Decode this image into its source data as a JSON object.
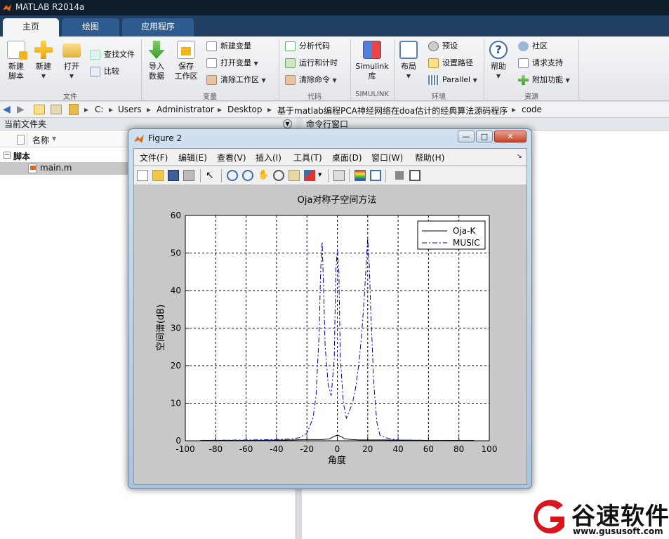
{
  "app": {
    "title": "MATLAB R2014a"
  },
  "tabs": [
    {
      "label": "主页"
    },
    {
      "label": "绘图"
    },
    {
      "label": "应用程序"
    }
  ],
  "ribbon": {
    "groups": {
      "file": "文件",
      "variable": "变量",
      "code": "代码",
      "simulink": "SIMULINK",
      "environment": "环境",
      "resources": "资源"
    },
    "new_script": "新建\n脚本",
    "new_script_l1": "新建",
    "new_script_l2": "脚本",
    "new": "新建",
    "open": "打开",
    "find_files": "查找文件",
    "compare": "比较",
    "import_l1": "导入",
    "import_l2": "数据",
    "save_ws_l1": "保存",
    "save_ws_l2": "工作区",
    "new_variable": "新建变量",
    "open_variable": "打开变量",
    "clear_workspace": "清除工作区",
    "analyze_code": "分析代码",
    "run_and_time": "运行和计时",
    "clear_commands": "清除命令",
    "simulink_l1": "Simulink",
    "simulink_l2": "库",
    "layout": "布局",
    "preferences": "预设",
    "set_path": "设置路径",
    "parallel": "Parallel",
    "help": "帮助",
    "community": "社区",
    "request_support": "请求支持",
    "add_ons": "附加功能"
  },
  "address": {
    "crumbs": [
      "C:",
      "Users",
      "Administrator",
      "Desktop",
      "基于matlab编程PCA神经网络在doa估计的经典算法源码程序",
      "code"
    ]
  },
  "current_folder": {
    "title": "当前文件夹",
    "col_name": "名称",
    "group": "脚本",
    "file": "main.m"
  },
  "command_window": {
    "title": "命令行窗口"
  },
  "figure": {
    "title": "Figure 2",
    "menu": [
      "文件(F)",
      "编辑(E)",
      "查看(V)",
      "插入(I)",
      "工具(T)",
      "桌面(D)",
      "窗口(W)",
      "帮助(H)"
    ]
  },
  "chart_data": {
    "type": "line",
    "title": "Oja对称子空间方法",
    "xlabel": "角度",
    "ylabel": "空间谱(dB)",
    "xlim": [
      -100,
      100
    ],
    "ylim": [
      0,
      60
    ],
    "xticks": [
      -100,
      -80,
      -60,
      -40,
      -20,
      0,
      20,
      40,
      60,
      80,
      100
    ],
    "yticks": [
      0,
      10,
      20,
      30,
      40,
      50,
      60
    ],
    "grid": true,
    "legend_position": "top-right",
    "series": [
      {
        "name": "Oja-K",
        "style": "solid",
        "color": "#000000",
        "x": [
          -90,
          -60,
          -30,
          -20,
          -10,
          -5,
          -2,
          0,
          2,
          5,
          10,
          15,
          20,
          25,
          30,
          60,
          90
        ],
        "y": [
          0.1,
          0.1,
          0.2,
          0.3,
          0.3,
          0.5,
          1.2,
          1.5,
          1.2,
          0.5,
          0.3,
          0.2,
          0.2,
          0.2,
          0.2,
          0.1,
          0.1
        ]
      },
      {
        "name": "MUSIC",
        "style": "dashdot",
        "color": "#0000aa",
        "x": [
          -90,
          -60,
          -40,
          -30,
          -25,
          -20,
          -16,
          -14,
          -12,
          -11,
          -10,
          -9,
          -8,
          -6,
          -4,
          -2,
          -1,
          0,
          1,
          2,
          4,
          6,
          8,
          10,
          12,
          14,
          16,
          18,
          19,
          20,
          21,
          22,
          24,
          26,
          28,
          32,
          35,
          40,
          60,
          90
        ],
        "y": [
          0.1,
          0.2,
          0.3,
          0.5,
          0.8,
          2,
          6,
          12,
          28,
          45,
          53,
          40,
          25,
          15,
          12,
          22,
          45,
          51,
          45,
          22,
          10,
          6,
          8,
          10,
          14,
          20,
          28,
          40,
          47,
          54,
          47,
          35,
          15,
          5,
          1.5,
          0.8,
          0.5,
          0.2,
          0.1,
          0.1
        ]
      }
    ]
  },
  "watermark": {
    "brand": "谷速软件",
    "url": "www.gususoft.com"
  }
}
